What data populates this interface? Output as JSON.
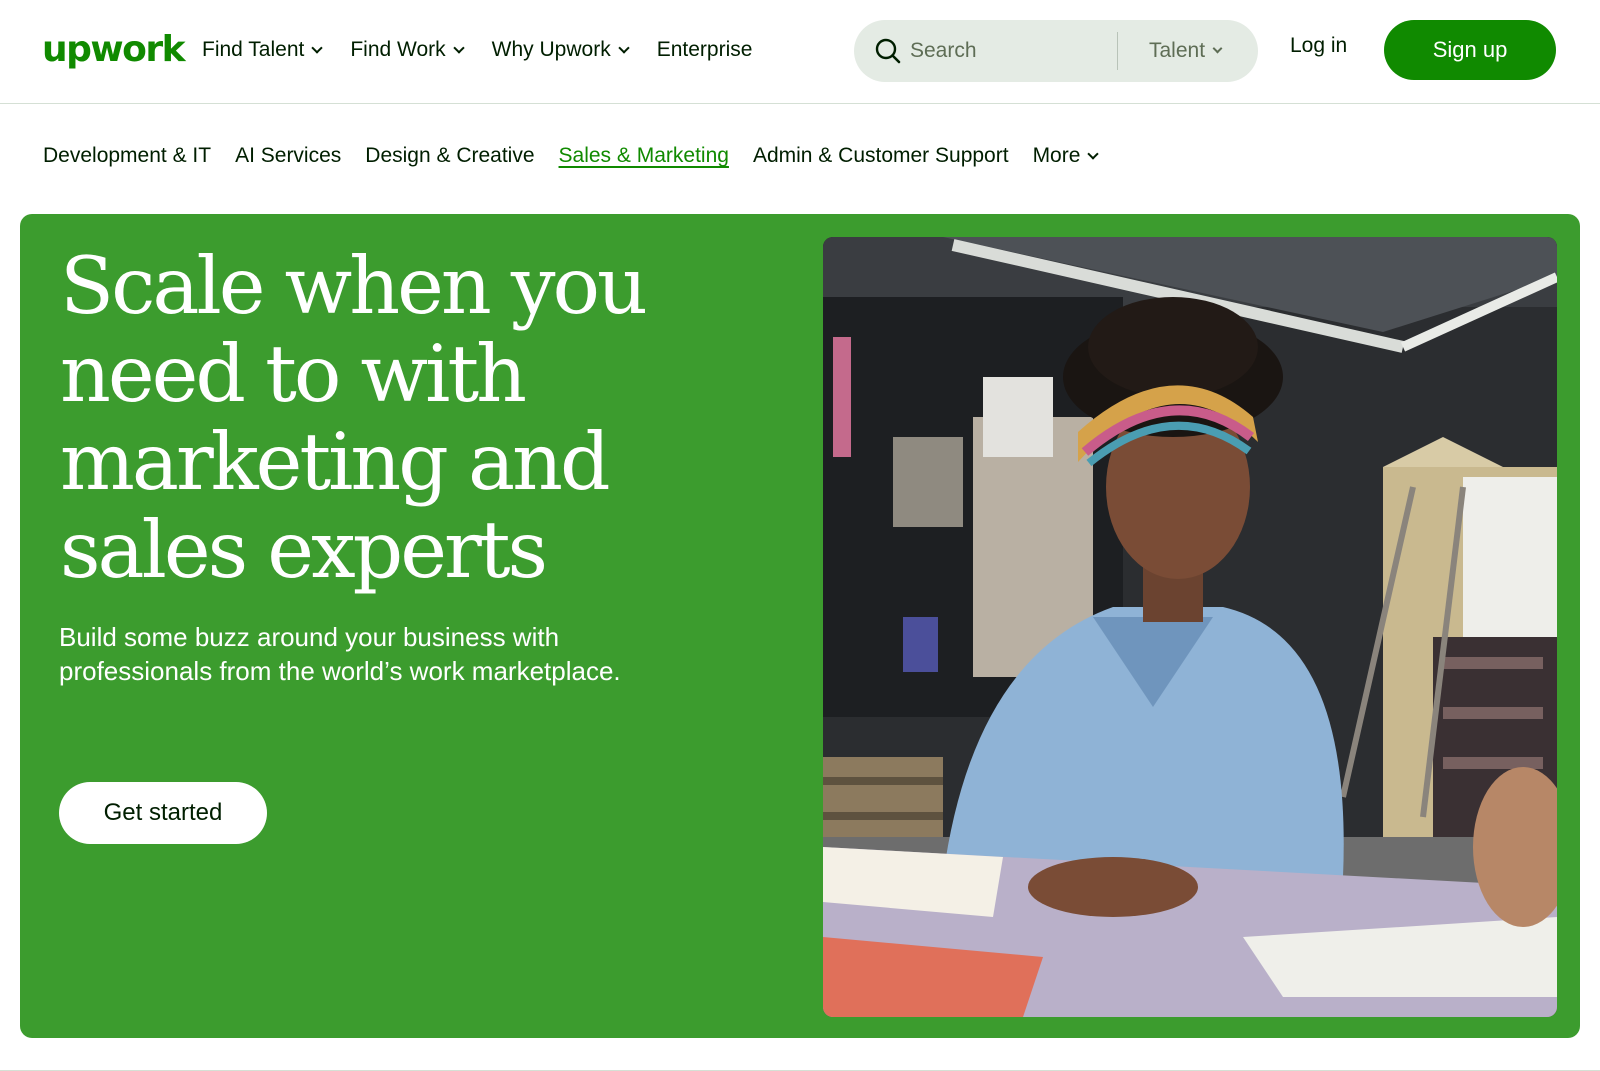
{
  "brand": {
    "logo_text": "upwork",
    "color": "#108a00"
  },
  "header": {
    "nav": [
      {
        "label": "Find Talent",
        "has_dropdown": true
      },
      {
        "label": "Find Work",
        "has_dropdown": true
      },
      {
        "label": "Why Upwork",
        "has_dropdown": true
      },
      {
        "label": "Enterprise",
        "has_dropdown": false
      }
    ],
    "search": {
      "placeholder": "Search",
      "value": "",
      "type_selected": "Talent",
      "icon": "search-icon"
    },
    "login_label": "Log in",
    "signup_label": "Sign up"
  },
  "categories": {
    "items": [
      {
        "label": "Development & IT",
        "active": false
      },
      {
        "label": "AI Services",
        "active": false
      },
      {
        "label": "Design & Creative",
        "active": false
      },
      {
        "label": "Sales & Marketing",
        "active": true
      },
      {
        "label": "Admin & Customer Support",
        "active": false
      }
    ],
    "more_label": "More"
  },
  "hero": {
    "title": "Scale when you need to with marketing and sales experts",
    "subtitle": "Build some buzz around your business with professionals from the world’s work marketplace.",
    "cta_label": "Get started",
    "background_color": "#3c9c2e",
    "image": "photo-woman-in-denim-shirt-at-workshop-table"
  },
  "colors": {
    "accent": "#108a00",
    "text": "#001e00",
    "search_bg": "#e4ebe4"
  }
}
